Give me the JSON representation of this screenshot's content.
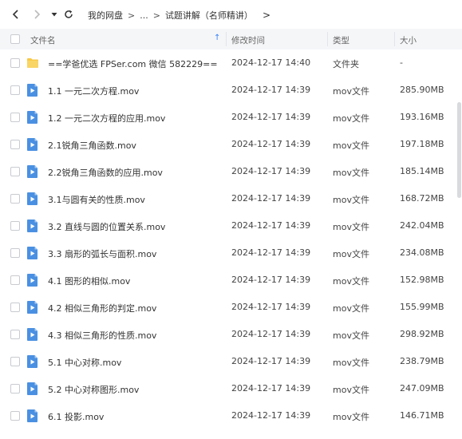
{
  "toolbar": {
    "back_icon": "chevron-left-icon",
    "forward_icon": "chevron-right-icon",
    "dropdown_icon": "caret-down-icon",
    "refresh_icon": "refresh-icon",
    "breadcrumb": {
      "root": "我的网盘",
      "sep1": ">",
      "ellipsis": "...",
      "sep2": ">",
      "current": "试题讲解（名师精讲）",
      "trail": ">"
    }
  },
  "columns": {
    "name": "文件名",
    "modified": "修改时间",
    "type": "类型",
    "size": "大小",
    "sort_indicator": "↑"
  },
  "colors": {
    "folder": "#f7c948",
    "video": "#4a90e2",
    "header_bg": "#f5f6f8",
    "sort_accent": "#3b82f6"
  },
  "files": [
    {
      "name": "==学爸优选 FPSer.com 微信 582229==",
      "modified": "2024-12-17 14:40",
      "type": "文件夹",
      "size": "-",
      "icon": "folder-icon"
    },
    {
      "name": "1.1 一元二次方程.mov",
      "modified": "2024-12-17 14:39",
      "type": "mov文件",
      "size": "285.90MB",
      "icon": "video-file-icon"
    },
    {
      "name": "1.2 一元二次方程的应用.mov",
      "modified": "2024-12-17 14:39",
      "type": "mov文件",
      "size": "193.16MB",
      "icon": "video-file-icon"
    },
    {
      "name": "2.1锐角三角函数.mov",
      "modified": "2024-12-17 14:39",
      "type": "mov文件",
      "size": "197.18MB",
      "icon": "video-file-icon"
    },
    {
      "name": "2.2锐角三角函数的应用.mov",
      "modified": "2024-12-17 14:39",
      "type": "mov文件",
      "size": "185.14MB",
      "icon": "video-file-icon"
    },
    {
      "name": "3.1与圆有关的性质.mov",
      "modified": "2024-12-17 14:39",
      "type": "mov文件",
      "size": "168.72MB",
      "icon": "video-file-icon"
    },
    {
      "name": "3.2 直线与圆的位置关系.mov",
      "modified": "2024-12-17 14:39",
      "type": "mov文件",
      "size": "242.04MB",
      "icon": "video-file-icon"
    },
    {
      "name": "3.3 扇形的弧长与面积.mov",
      "modified": "2024-12-17 14:39",
      "type": "mov文件",
      "size": "234.08MB",
      "icon": "video-file-icon"
    },
    {
      "name": "4.1 图形的相似.mov",
      "modified": "2024-12-17 14:39",
      "type": "mov文件",
      "size": "152.98MB",
      "icon": "video-file-icon"
    },
    {
      "name": "4.2 相似三角形的判定.mov",
      "modified": "2024-12-17 14:39",
      "type": "mov文件",
      "size": "155.99MB",
      "icon": "video-file-icon"
    },
    {
      "name": "4.3 相似三角形的性质.mov",
      "modified": "2024-12-17 14:39",
      "type": "mov文件",
      "size": "298.92MB",
      "icon": "video-file-icon"
    },
    {
      "name": "5.1 中心对称.mov",
      "modified": "2024-12-17 14:39",
      "type": "mov文件",
      "size": "238.79MB",
      "icon": "video-file-icon"
    },
    {
      "name": "5.2 中心对称图形.mov",
      "modified": "2024-12-17 14:39",
      "type": "mov文件",
      "size": "247.09MB",
      "icon": "video-file-icon"
    },
    {
      "name": "6.1 投影.mov",
      "modified": "2024-12-17 14:39",
      "type": "mov文件",
      "size": "146.71MB",
      "icon": "video-file-icon"
    }
  ]
}
